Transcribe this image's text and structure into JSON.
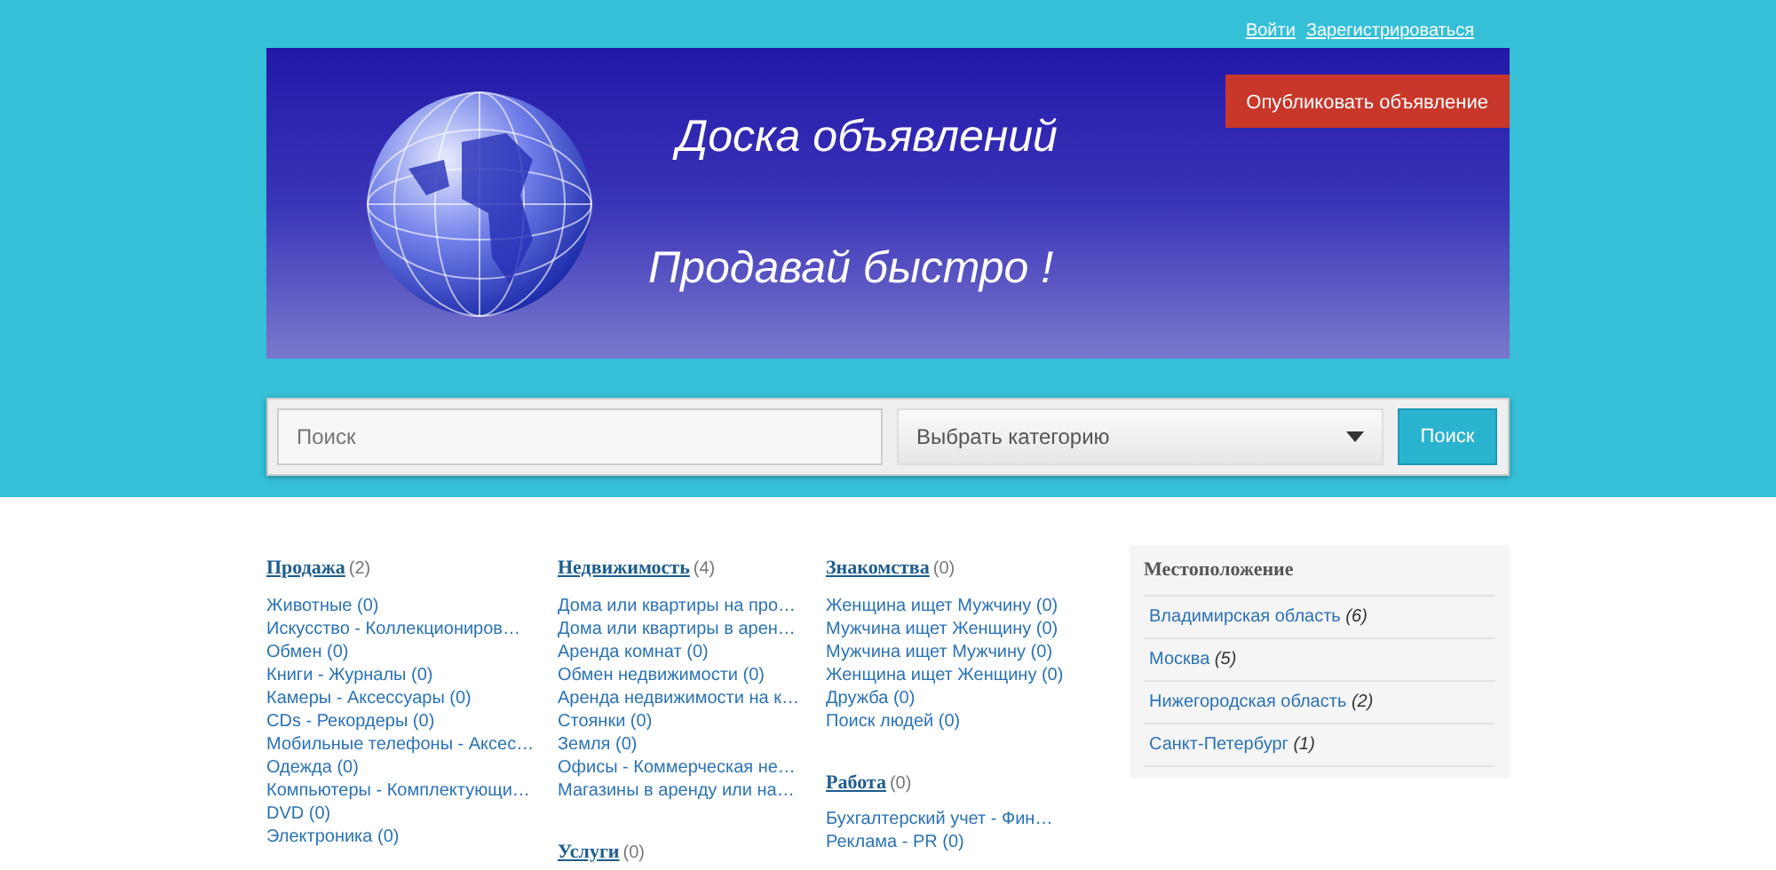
{
  "header": {
    "links": [
      "Войти",
      "Зарегистрироваться"
    ],
    "publish_button": "Опубликовать объявление",
    "banner_title": "Доска объявлений",
    "banner_slogan": "Продавай быстро !"
  },
  "search": {
    "placeholder": "Поиск",
    "category_placeholder": "Выбрать категорию",
    "button": "Поиск"
  },
  "category_columns": [
    {
      "groups": [
        {
          "title": "Продажа",
          "count": "(2)",
          "items": [
            "Животные (0)",
            "Искусство - Коллекциониров…",
            "Обмен (0)",
            "Книги - Журналы (0)",
            "Камеры - Аксессуары (0)",
            "CDs - Рекордеры (0)",
            "Мобильные телефоны - Аксес…",
            "Одежда (0)",
            "Компьютеры - Комплектующи…",
            "DVD (0)",
            "Электроника (0)"
          ]
        }
      ]
    },
    {
      "groups": [
        {
          "title": "Недвижимость",
          "count": "(4)",
          "items": [
            "Дома или квартиры на про…",
            "Дома или квартиры в арен…",
            "Аренда комнат (0)",
            "Обмен недвижимости (0)",
            "Аренда недвижимости на к…",
            "Стоянки (0)",
            "Земля (0)",
            "Офисы - Коммерческая не…",
            "Магазины в аренду или на…"
          ]
        },
        {
          "title": "Услуги",
          "count": "(0)"
        }
      ]
    },
    {
      "groups": [
        {
          "title": "Знакомства",
          "count": "(0)",
          "items": [
            "Женщина ищет Мужчину (0)",
            "Мужчина ищет Женщину (0)",
            "Мужчина ищет Мужчину (0)",
            "Женщина ищет Женщину (0)",
            "Дружба (0)",
            "Поиск людей (0)"
          ]
        },
        {
          "title": "Работа",
          "count": "(0)",
          "items": [
            "Бухгалтерский учет - Фин…",
            "Реклама - PR (0)"
          ]
        }
      ]
    }
  ],
  "locations": {
    "title": "Местоположение",
    "items": [
      {
        "name": "Владимирская область",
        "count": "(6)"
      },
      {
        "name": "Москва",
        "count": "(5)"
      },
      {
        "name": "Нижегородская область",
        "count": "(2)"
      },
      {
        "name": "Санкт-Петербург",
        "count": "(1)"
      }
    ]
  }
}
